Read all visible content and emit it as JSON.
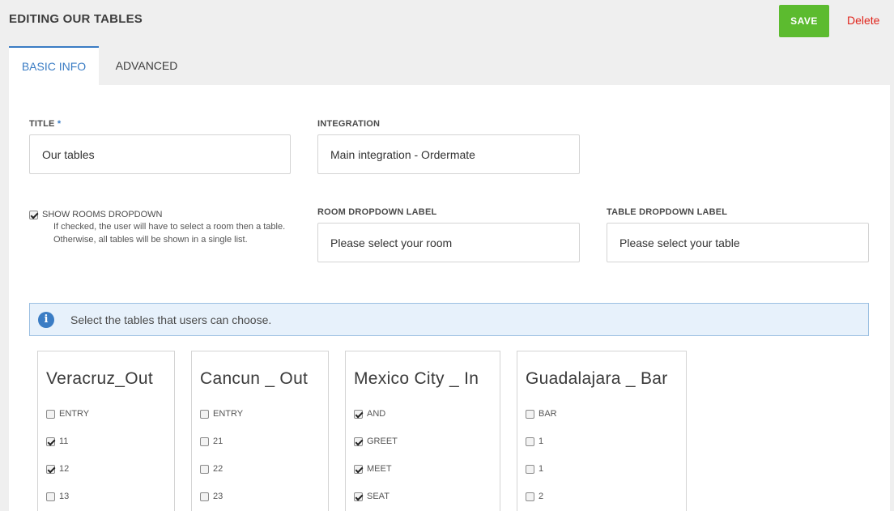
{
  "header": {
    "title": "EDITING OUR TABLES",
    "save_label": "SAVE",
    "delete_label": "Delete"
  },
  "tabs": [
    {
      "label": "BASIC INFO",
      "active": true
    },
    {
      "label": "ADVANCED",
      "active": false
    }
  ],
  "form": {
    "title": {
      "label": "TITLE",
      "required_marker": "*",
      "value": "Our tables"
    },
    "integration": {
      "label": "INTEGRATION",
      "value": "Main integration - Ordermate"
    },
    "show_rooms": {
      "label": "SHOW ROOMS DROPDOWN",
      "checked": true,
      "help": "If checked, the user will have to select a room then a table. Otherwise, all tables will be shown in a single list."
    },
    "room_dropdown": {
      "label": "ROOM DROPDOWN LABEL",
      "value": "Please select your room"
    },
    "table_dropdown": {
      "label": "TABLE DROPDOWN LABEL",
      "value": "Please select your table"
    }
  },
  "info": {
    "icon": "info-icon",
    "text": "Select the tables that users can choose."
  },
  "rooms": [
    {
      "name": "Veracruz_Out",
      "tables": [
        {
          "label": "ENTRY",
          "checked": false
        },
        {
          "label": "11",
          "checked": true
        },
        {
          "label": "12",
          "checked": true
        },
        {
          "label": "13",
          "checked": false
        }
      ]
    },
    {
      "name": "Cancun _ Out",
      "tables": [
        {
          "label": "ENTRY",
          "checked": false
        },
        {
          "label": "21",
          "checked": false
        },
        {
          "label": "22",
          "checked": false
        },
        {
          "label": "23",
          "checked": false
        }
      ]
    },
    {
      "name": "Mexico City _ In",
      "tables": [
        {
          "label": "AND",
          "checked": true
        },
        {
          "label": "GREET",
          "checked": true
        },
        {
          "label": "MEET",
          "checked": true
        },
        {
          "label": "SEAT",
          "checked": true
        }
      ]
    },
    {
      "name": "Guadalajara _ Bar",
      "tables": [
        {
          "label": "BAR",
          "checked": false
        },
        {
          "label": "1",
          "checked": false
        },
        {
          "label": "1",
          "checked": false
        },
        {
          "label": "2",
          "checked": false
        }
      ]
    }
  ],
  "colors": {
    "accent": "#3a7cc4",
    "save_green": "#5cbb2f",
    "delete_red": "#e0241b"
  }
}
